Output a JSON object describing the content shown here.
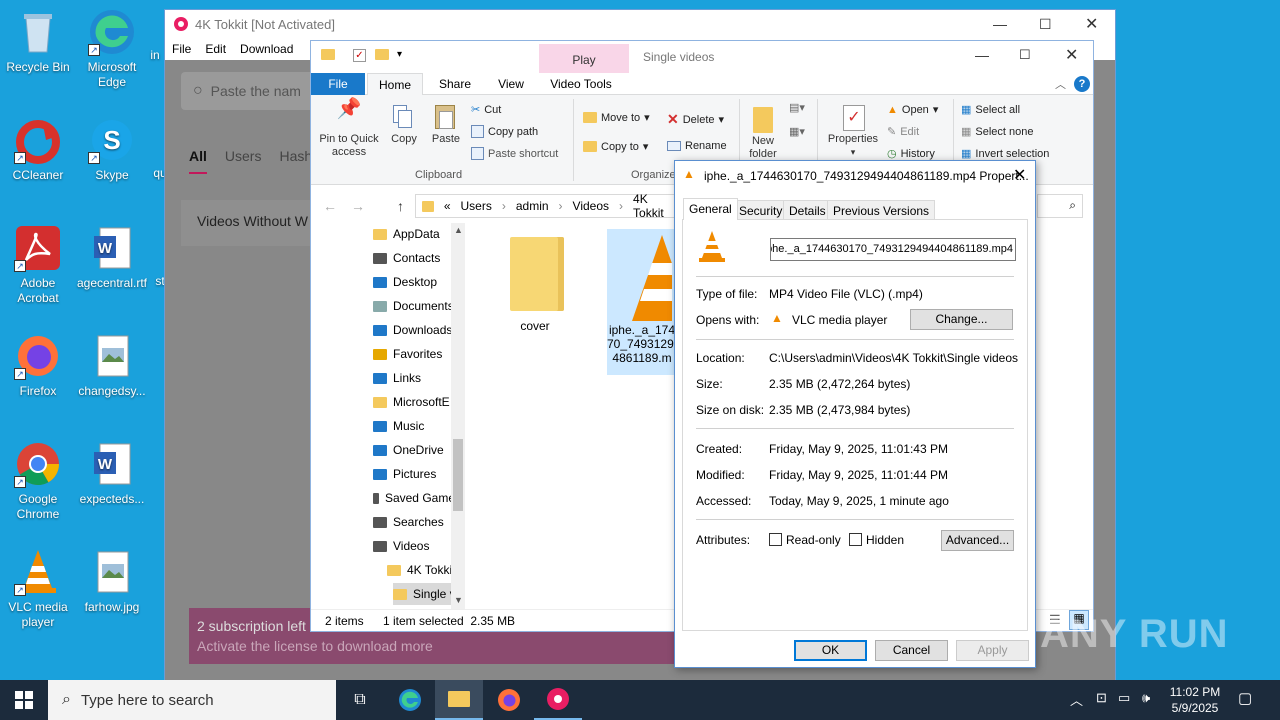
{
  "desktop": {
    "icons": [
      {
        "id": "recycle",
        "label": "Recycle Bin"
      },
      {
        "id": "edge",
        "label": "Microsoft Edge"
      },
      {
        "id": "in",
        "label": "in"
      },
      {
        "id": "ccleaner",
        "label": "CCleaner"
      },
      {
        "id": "skype",
        "label": "Skype"
      },
      {
        "id": "qu",
        "label": "qu"
      },
      {
        "id": "acrobat",
        "label": "Adobe Acrobat"
      },
      {
        "id": "agecentral",
        "label": "agecentral.rtf"
      },
      {
        "id": "st",
        "label": "st"
      },
      {
        "id": "firefox",
        "label": "Firefox"
      },
      {
        "id": "changedsy",
        "label": "changedsy..."
      },
      {
        "id": "chrome",
        "label": "Google Chrome"
      },
      {
        "id": "expecteds",
        "label": "expecteds..."
      },
      {
        "id": "vlc",
        "label": "VLC media player"
      },
      {
        "id": "farhow",
        "label": "farhow.jpg"
      }
    ]
  },
  "tokkit": {
    "title": "4K Tokkit [Not Activated]",
    "menu": [
      "File",
      "Edit",
      "Download"
    ],
    "search_placeholder": "Paste the nam",
    "tabs": [
      "All",
      "Users",
      "Hash"
    ],
    "item": "Videos Without W",
    "banner_line1": "2 subscription left",
    "banner_line2": "Activate the license to download more"
  },
  "explorer": {
    "qat_label": "Play",
    "title": "Single videos",
    "tabs": [
      "File",
      "Home",
      "Share",
      "View",
      "Video Tools"
    ],
    "clipboard": {
      "pin": "Pin to Quick access",
      "copy": "Copy",
      "paste": "Paste",
      "cut": "Cut",
      "copy_path": "Copy path",
      "paste_shortcut": "Paste shortcut",
      "group": "Clipboard"
    },
    "organize": {
      "move_to": "Move to",
      "copy_to": "Copy to",
      "delete": "Delete",
      "rename": "Rename",
      "group": "Organize"
    },
    "new": {
      "new_folder": "New folder"
    },
    "open": {
      "properties": "Properties",
      "open": "Open",
      "edit": "Edit",
      "history": "History"
    },
    "select": {
      "all": "Select all",
      "none": "Select none",
      "invert": "Invert selection"
    },
    "path": [
      "«",
      "Users",
      "admin",
      "Videos",
      "4K Tokkit"
    ],
    "tree": [
      "AppData",
      "Contacts",
      "Desktop",
      "Documents",
      "Downloads",
      "Favorites",
      "Links",
      "MicrosoftE",
      "Music",
      "OneDrive",
      "Pictures",
      "Saved Games",
      "Searches",
      "Videos",
      "4K Tokkit",
      "Single v"
    ],
    "files": [
      {
        "name": "cover"
      },
      {
        "name": "iphe._a_1744630170_7493129494404861189.mp4"
      }
    ],
    "file_label_lines": [
      "iphe._a_174",
      "70_74931294",
      "4861189.m"
    ],
    "status_items": "2 items",
    "status_selected": "1 item selected  2.35 MB"
  },
  "props": {
    "title": "iphe._a_1744630170_7493129494404861189.mp4 Propert...",
    "tabs": [
      "General",
      "Security",
      "Details",
      "Previous Versions"
    ],
    "filename": "iphe._a_1744630170_7493129494404861189.mp4",
    "type_label": "Type of file:",
    "type_value": "MP4 Video File (VLC) (.mp4)",
    "opens_label": "Opens with:",
    "opens_value": "VLC media player",
    "change": "Change...",
    "location_label": "Location:",
    "location_value": "C:\\Users\\admin\\Videos\\4K Tokkit\\Single videos",
    "size_label": "Size:",
    "size_value": "2.35 MB (2,472,264 bytes)",
    "disk_label": "Size on disk:",
    "disk_value": "2.35 MB (2,473,984 bytes)",
    "created_label": "Created:",
    "created_value": "Friday, May 9, 2025, 11:01:43 PM",
    "modified_label": "Modified:",
    "modified_value": "Friday, May 9, 2025, 11:01:44 PM",
    "accessed_label": "Accessed:",
    "accessed_value": "Today, May 9, 2025, 1 minute ago",
    "attr_label": "Attributes:",
    "readonly": "Read-only",
    "hidden": "Hidden",
    "advanced": "Advanced...",
    "ok": "OK",
    "cancel": "Cancel",
    "apply": "Apply"
  },
  "taskbar": {
    "search_placeholder": "Type here to search",
    "time": "11:02 PM",
    "date": "5/9/2025"
  },
  "watermark": "ANY RUN"
}
